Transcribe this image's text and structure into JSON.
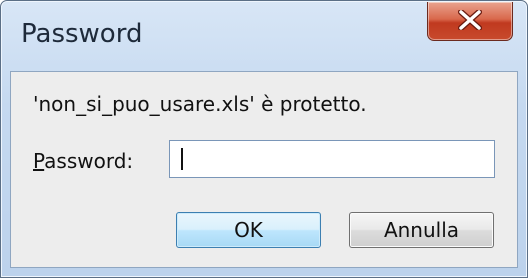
{
  "window": {
    "title": "Password"
  },
  "dialog": {
    "message": "'non_si_puo_usare.xls' è protetto.",
    "password_label_first": "P",
    "password_label_rest": "assword:",
    "password_value": "",
    "ok_label": "OK",
    "cancel_label": "Annulla"
  },
  "icons": {
    "close": "close-icon"
  },
  "colors": {
    "close_button": "#c84a2d",
    "default_button_border": "#3c7fb1",
    "title_text": "#1e2a3a"
  }
}
